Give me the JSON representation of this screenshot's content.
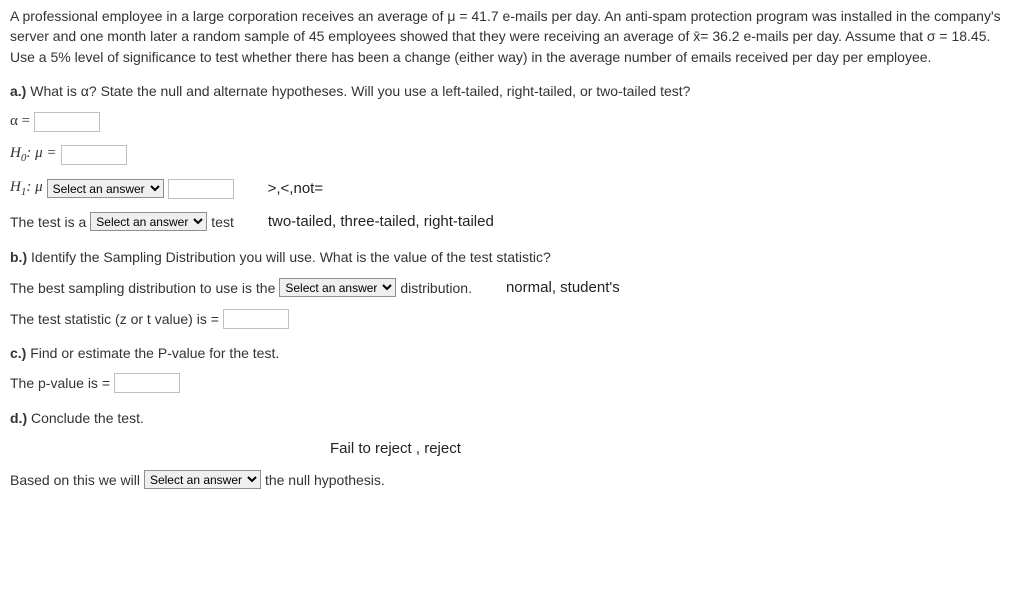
{
  "problem": "A professional employee in a large corporation receives an average of μ = 41.7 e-mails per day. An anti-spam protection program was installed in the company's server and one month later a random sample of 45 employees showed that they were receiving an average of x̄= 36.2 e-mails per day. Assume that σ = 18.45. Use a 5% level of significance to test whether there has been a change (either way) in the average number of emails received per day per employee.",
  "a": {
    "label": "a.)",
    "prompt": " What is α? State the null and alternate hypotheses. Will you use a left-tailed, right-tailed, or two-tailed test?",
    "alpha_label": "α = ",
    "h0_prefix": "H",
    "h0_sub": "0",
    "h0_rest": ": μ = ",
    "h1_prefix": "H",
    "h1_sub": "1",
    "h1_rest": ": μ ",
    "select_placeholder": "Select an answer",
    "h1_hint": ">,<,not=",
    "test_prefix": "The test is a ",
    "test_suffix": " test",
    "test_hint": "two-tailed, three-tailed, right-tailed"
  },
  "b": {
    "label": "b.)",
    "prompt": " Identify the Sampling Distribution you will use. What is the value of the test statistic?",
    "dist_prefix": "The best sampling distribution to use is the ",
    "dist_suffix": " distribution.",
    "dist_hint": "normal, student's",
    "stat_label": "The test statistic (z or t value) is = "
  },
  "c": {
    "label": "c.)",
    "prompt": " Find or estimate the P-value for the test.",
    "pvalue_label": "The p-value is = "
  },
  "d": {
    "label": "d.)",
    "prompt": " Conclude the test.",
    "concl_hint": "Fail to reject , reject",
    "concl_prefix": "Based on this we will ",
    "concl_suffix": " the null hypothesis."
  }
}
